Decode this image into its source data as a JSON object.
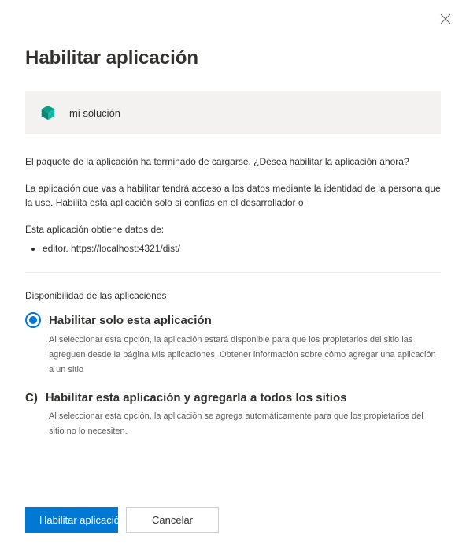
{
  "dialog": {
    "title": "Habilitar aplicación",
    "app_name": "mi solución",
    "intro": "El paquete de la aplicación ha terminado de cargarse. ¿Desea habilitar la aplicación ahora?",
    "access_note": "La aplicación que vas a habilitar tendrá acceso a los datos mediante la identidad de la persona que la use. Habilita esta aplicación solo si confías en el desarrollador o",
    "data_from_label": "Esta aplicación obtiene datos de:",
    "data_sources": [
      "editor. https://localhost:4321/dist/"
    ],
    "availability_label": "Disponibilidad de las aplicaciones",
    "options": {
      "enable_only": {
        "title": "Habilitar solo esta aplicación",
        "desc": "Al seleccionar esta opción, la aplicación estará disponible para que los propietarios del sitio las agreguen desde la página Mis aplicaciones.  Obtener información sobre cómo agregar una aplicación a un sitio"
      },
      "enable_all": {
        "prefix": "C)",
        "title": "Habilitar esta aplicación y agregarla a todos los sitios",
        "desc": "Al seleccionar esta opción, la aplicación se agrega automáticamente para que los propietarios del sitio no lo necesiten."
      }
    },
    "buttons": {
      "primary": "Habilitar aplicación",
      "secondary": "Cancelar"
    }
  }
}
